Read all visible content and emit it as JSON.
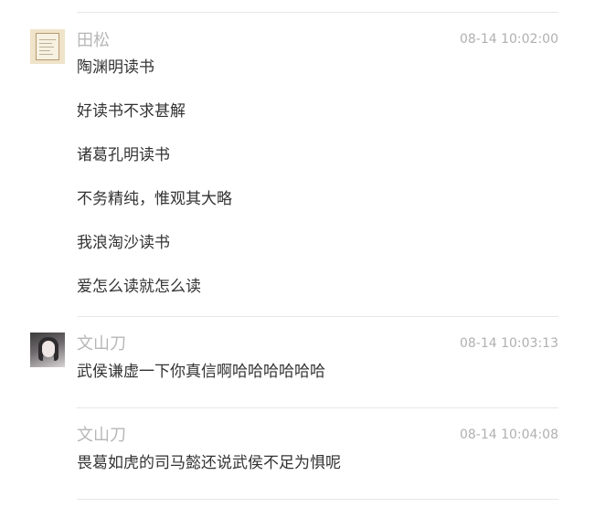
{
  "comments": [
    {
      "username": "田松",
      "time": "08-14 10:02:00",
      "avatar": "book-avatar",
      "lines": [
        "陶渊明读书",
        "好读书不求甚解",
        "诸葛孔明读书",
        "不务精纯，惟观其大略",
        "我浪淘沙读书",
        "爱怎么读就怎么读"
      ]
    },
    {
      "username": "文山刀",
      "time": "08-14 10:03:13",
      "avatar": "girl-avatar",
      "lines": [
        "武侯谦虚一下你真信啊哈哈哈哈哈哈"
      ]
    },
    {
      "username": "文山刀",
      "time": "08-14 10:04:08",
      "avatar": "",
      "lines": [
        "畏葛如虎的司马懿还说武侯不足为惧呢"
      ]
    }
  ]
}
